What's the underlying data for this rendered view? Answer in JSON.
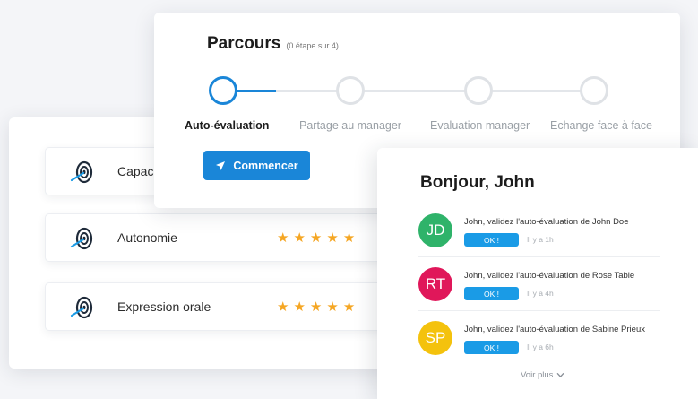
{
  "parcours": {
    "title": "Parcours",
    "subtitle": "(0 étape sur 4)",
    "steps": [
      {
        "label": "Auto-évaluation"
      },
      {
        "label": "Partage au manager"
      },
      {
        "label": "Evaluation manager"
      },
      {
        "label": "Echange face à face"
      }
    ],
    "start_label": "Commencer"
  },
  "skills": {
    "items": [
      {
        "label": "Capac",
        "stars": null
      },
      {
        "label": "Autonomie",
        "stars": 5
      },
      {
        "label": "Expression orale",
        "stars": 5
      }
    ],
    "star_glyph": "★"
  },
  "notifications": {
    "title": "Bonjour, John",
    "items": [
      {
        "initials": "JD",
        "color": "#2fb36a",
        "text": "John, validez l'auto-évaluation de John Doe",
        "ok_label": "OK !",
        "time": "Il y a 1h"
      },
      {
        "initials": "RT",
        "color": "#e0175a",
        "text": "John, validez l'auto-évaluation de Rose Table",
        "ok_label": "OK !",
        "time": "Il y a 4h"
      },
      {
        "initials": "SP",
        "color": "#f4c20d",
        "text": "John, validez l'auto-évaluation de Sabine Prieux",
        "ok_label": "OK !",
        "time": "Il y a 6h"
      }
    ],
    "more_label": "Voir plus"
  },
  "colors": {
    "accent": "#1a86d8",
    "star": "#f5a623",
    "ok": "#1a9be6"
  }
}
